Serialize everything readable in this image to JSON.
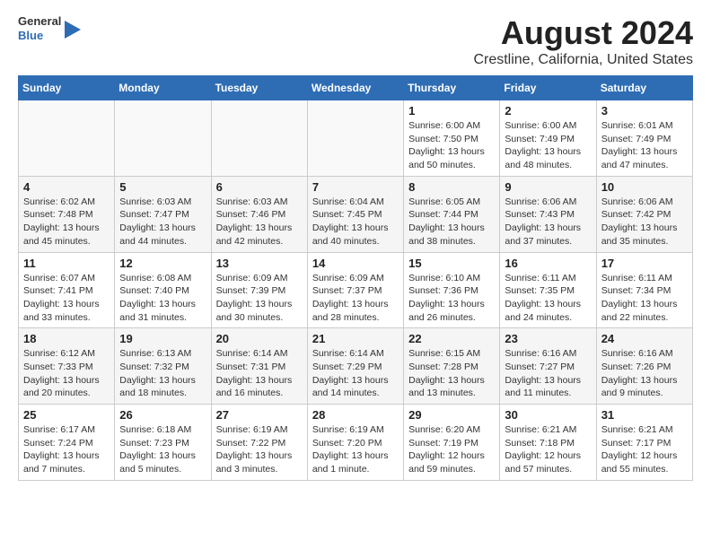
{
  "header": {
    "logo_general": "General",
    "logo_blue": "Blue",
    "title": "August 2024",
    "subtitle": "Crestline, California, United States"
  },
  "calendar": {
    "weekdays": [
      "Sunday",
      "Monday",
      "Tuesday",
      "Wednesday",
      "Thursday",
      "Friday",
      "Saturday"
    ],
    "weeks": [
      [
        {
          "day": "",
          "info": ""
        },
        {
          "day": "",
          "info": ""
        },
        {
          "day": "",
          "info": ""
        },
        {
          "day": "",
          "info": ""
        },
        {
          "day": "1",
          "info": "Sunrise: 6:00 AM\nSunset: 7:50 PM\nDaylight: 13 hours\nand 50 minutes."
        },
        {
          "day": "2",
          "info": "Sunrise: 6:00 AM\nSunset: 7:49 PM\nDaylight: 13 hours\nand 48 minutes."
        },
        {
          "day": "3",
          "info": "Sunrise: 6:01 AM\nSunset: 7:49 PM\nDaylight: 13 hours\nand 47 minutes."
        }
      ],
      [
        {
          "day": "4",
          "info": "Sunrise: 6:02 AM\nSunset: 7:48 PM\nDaylight: 13 hours\nand 45 minutes."
        },
        {
          "day": "5",
          "info": "Sunrise: 6:03 AM\nSunset: 7:47 PM\nDaylight: 13 hours\nand 44 minutes."
        },
        {
          "day": "6",
          "info": "Sunrise: 6:03 AM\nSunset: 7:46 PM\nDaylight: 13 hours\nand 42 minutes."
        },
        {
          "day": "7",
          "info": "Sunrise: 6:04 AM\nSunset: 7:45 PM\nDaylight: 13 hours\nand 40 minutes."
        },
        {
          "day": "8",
          "info": "Sunrise: 6:05 AM\nSunset: 7:44 PM\nDaylight: 13 hours\nand 38 minutes."
        },
        {
          "day": "9",
          "info": "Sunrise: 6:06 AM\nSunset: 7:43 PM\nDaylight: 13 hours\nand 37 minutes."
        },
        {
          "day": "10",
          "info": "Sunrise: 6:06 AM\nSunset: 7:42 PM\nDaylight: 13 hours\nand 35 minutes."
        }
      ],
      [
        {
          "day": "11",
          "info": "Sunrise: 6:07 AM\nSunset: 7:41 PM\nDaylight: 13 hours\nand 33 minutes."
        },
        {
          "day": "12",
          "info": "Sunrise: 6:08 AM\nSunset: 7:40 PM\nDaylight: 13 hours\nand 31 minutes."
        },
        {
          "day": "13",
          "info": "Sunrise: 6:09 AM\nSunset: 7:39 PM\nDaylight: 13 hours\nand 30 minutes."
        },
        {
          "day": "14",
          "info": "Sunrise: 6:09 AM\nSunset: 7:37 PM\nDaylight: 13 hours\nand 28 minutes."
        },
        {
          "day": "15",
          "info": "Sunrise: 6:10 AM\nSunset: 7:36 PM\nDaylight: 13 hours\nand 26 minutes."
        },
        {
          "day": "16",
          "info": "Sunrise: 6:11 AM\nSunset: 7:35 PM\nDaylight: 13 hours\nand 24 minutes."
        },
        {
          "day": "17",
          "info": "Sunrise: 6:11 AM\nSunset: 7:34 PM\nDaylight: 13 hours\nand 22 minutes."
        }
      ],
      [
        {
          "day": "18",
          "info": "Sunrise: 6:12 AM\nSunset: 7:33 PM\nDaylight: 13 hours\nand 20 minutes."
        },
        {
          "day": "19",
          "info": "Sunrise: 6:13 AM\nSunset: 7:32 PM\nDaylight: 13 hours\nand 18 minutes."
        },
        {
          "day": "20",
          "info": "Sunrise: 6:14 AM\nSunset: 7:31 PM\nDaylight: 13 hours\nand 16 minutes."
        },
        {
          "day": "21",
          "info": "Sunrise: 6:14 AM\nSunset: 7:29 PM\nDaylight: 13 hours\nand 14 minutes."
        },
        {
          "day": "22",
          "info": "Sunrise: 6:15 AM\nSunset: 7:28 PM\nDaylight: 13 hours\nand 13 minutes."
        },
        {
          "day": "23",
          "info": "Sunrise: 6:16 AM\nSunset: 7:27 PM\nDaylight: 13 hours\nand 11 minutes."
        },
        {
          "day": "24",
          "info": "Sunrise: 6:16 AM\nSunset: 7:26 PM\nDaylight: 13 hours\nand 9 minutes."
        }
      ],
      [
        {
          "day": "25",
          "info": "Sunrise: 6:17 AM\nSunset: 7:24 PM\nDaylight: 13 hours\nand 7 minutes."
        },
        {
          "day": "26",
          "info": "Sunrise: 6:18 AM\nSunset: 7:23 PM\nDaylight: 13 hours\nand 5 minutes."
        },
        {
          "day": "27",
          "info": "Sunrise: 6:19 AM\nSunset: 7:22 PM\nDaylight: 13 hours\nand 3 minutes."
        },
        {
          "day": "28",
          "info": "Sunrise: 6:19 AM\nSunset: 7:20 PM\nDaylight: 13 hours\nand 1 minute."
        },
        {
          "day": "29",
          "info": "Sunrise: 6:20 AM\nSunset: 7:19 PM\nDaylight: 12 hours\nand 59 minutes."
        },
        {
          "day": "30",
          "info": "Sunrise: 6:21 AM\nSunset: 7:18 PM\nDaylight: 12 hours\nand 57 minutes."
        },
        {
          "day": "31",
          "info": "Sunrise: 6:21 AM\nSunset: 7:17 PM\nDaylight: 12 hours\nand 55 minutes."
        }
      ]
    ]
  }
}
